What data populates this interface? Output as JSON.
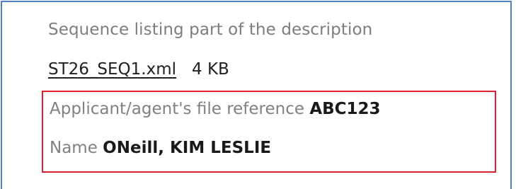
{
  "sequence_listing": {
    "title": "Sequence listing part of the description",
    "file_name": "ST26_SEQ1.xml",
    "file_size": "4 KB"
  },
  "applicant": {
    "file_reference_label": "Applicant/agent's file reference",
    "file_reference_value": "ABC123",
    "name_label": "Name",
    "name_value": "ONeill, KIM LESLIE"
  },
  "colors": {
    "panel_border": "#4f7fc4",
    "highlight_border": "#e0202a",
    "label_text": "#808080",
    "value_text": "#1a1a1a"
  }
}
